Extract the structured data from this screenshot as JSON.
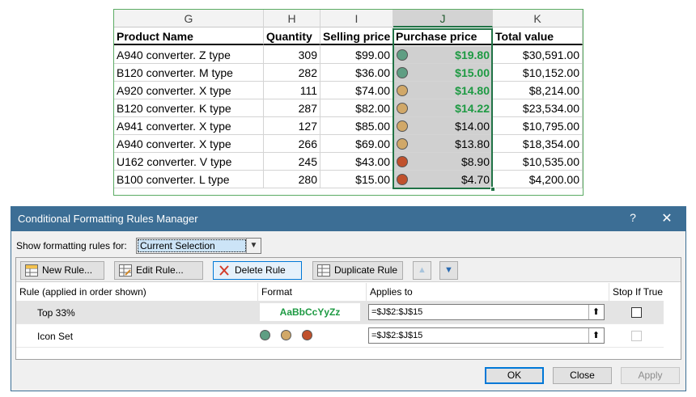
{
  "sheet": {
    "columns": [
      {
        "letter": "G",
        "header": "Product Name"
      },
      {
        "letter": "H",
        "header": "Quantity"
      },
      {
        "letter": "I",
        "header": "Selling price"
      },
      {
        "letter": "J",
        "header": "Purchase price"
      },
      {
        "letter": "K",
        "header": "Total value"
      }
    ],
    "rows": [
      {
        "product": "A940 converter. Z type",
        "qty": "309",
        "sell": "$99.00",
        "purchase": "$19.80",
        "total": "$30,591.00",
        "icon": "green",
        "top": true
      },
      {
        "product": "B120 converter. M type",
        "qty": "282",
        "sell": "$36.00",
        "purchase": "$15.00",
        "total": "$10,152.00",
        "icon": "green",
        "top": true
      },
      {
        "product": "A920 converter. X type",
        "qty": "111",
        "sell": "$74.00",
        "purchase": "$14.80",
        "total": "$8,214.00",
        "icon": "yellow",
        "top": true
      },
      {
        "product": "B120 converter. K type",
        "qty": "287",
        "sell": "$82.00",
        "purchase": "$14.22",
        "total": "$23,534.00",
        "icon": "yellow",
        "top": true
      },
      {
        "product": "A941 converter. X type",
        "qty": "127",
        "sell": "$85.00",
        "purchase": "$14.00",
        "total": "$10,795.00",
        "icon": "yellow",
        "top": false
      },
      {
        "product": "A940 converter. X type",
        "qty": "266",
        "sell": "$69.00",
        "purchase": "$13.80",
        "total": "$18,354.00",
        "icon": "yellow",
        "top": false
      },
      {
        "product": "U162 converter. V type",
        "qty": "245",
        "sell": "$43.00",
        "purchase": "$8.90",
        "total": "$10,535.00",
        "icon": "red",
        "top": false
      },
      {
        "product": "B100 converter. L type",
        "qty": "280",
        "sell": "$15.00",
        "purchase": "$4.70",
        "total": "$4,200.00",
        "icon": "red",
        "top": false
      }
    ],
    "icon_colors": {
      "green": "#5f9e83",
      "yellow": "#d1a868",
      "red": "#c0512c"
    },
    "highlight_color": "#1e9a43"
  },
  "dialog": {
    "title": "Conditional Formatting Rules Manager",
    "help": "?",
    "close": "✕",
    "show_rules_label": "Show formatting rules for:",
    "show_rules_value": "Current Selection",
    "toolbar": {
      "new_rule": "New Rule...",
      "edit_rule": "Edit Rule...",
      "delete_rule": "Delete Rule",
      "duplicate_rule": "Duplicate Rule",
      "move_up": "▲",
      "move_down": "▼"
    },
    "list_headers": {
      "rule": "Rule (applied in order shown)",
      "format": "Format",
      "applies_to": "Applies to",
      "stop_if_true": "Stop If True"
    },
    "rules": [
      {
        "name": "Top 33%",
        "format_preview": "AaBbCcYyZz",
        "applies_to": "=$J$2:$J$15",
        "picker": "⬆"
      },
      {
        "name": "Icon Set",
        "format_preview": "",
        "applies_to": "=$J$2:$J$15",
        "picker": "⬆"
      }
    ],
    "buttons": {
      "ok": "OK",
      "close": "Close",
      "apply": "Apply"
    }
  }
}
